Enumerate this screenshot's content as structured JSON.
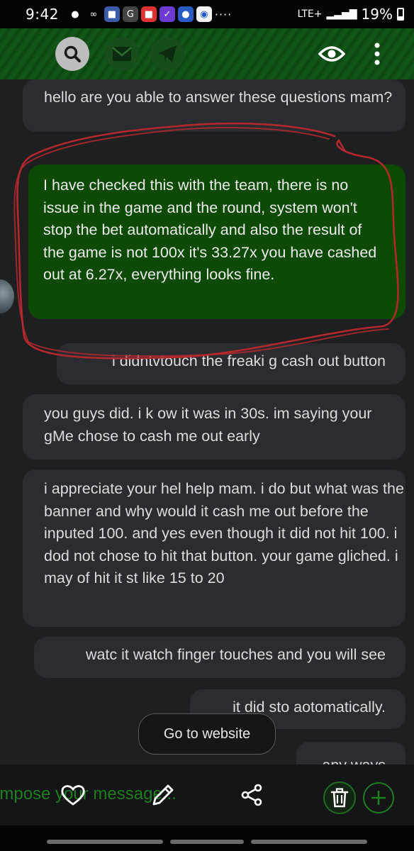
{
  "status_bar": {
    "time": "9:42",
    "network": "LTE+",
    "battery": "19%",
    "more_dots": "····"
  },
  "top_bar": {
    "icons": [
      "search-icon",
      "mail-icon",
      "send-icon",
      "eye-icon",
      "more-vertical-icon"
    ]
  },
  "messages": [
    {
      "side": "left",
      "text": "hello are you able to answer these questions mam?"
    },
    {
      "side": "agent",
      "text": "I have checked this with the team, there is no issue in the game and the round, system won't stop the bet automatically and also the result of the game is not 100x it's 33.27x you have cashed out at 6.27x, everything looks fine."
    },
    {
      "side": "right",
      "text": "i didntvtouch the freaki g cash out button"
    },
    {
      "side": "left",
      "text": "you guys did. i k ow it was in 30s. im saying your gMe chose to cash me out early"
    },
    {
      "side": "left",
      "text": "i appreciate your hel help mam. i do but what was the banner and why would it cash me out before the inputed 100. and yes even though it did not hit 100. i dod not chose to hit that button. your game gliched. i may of hit it st like 15 to 20"
    },
    {
      "side": "right",
      "text": "watc it watch finger touches and you will see"
    },
    {
      "side": "right",
      "text": "it did sto aotomatically."
    },
    {
      "side": "right",
      "text": "any ways"
    }
  ],
  "go_to_website": "Go to website",
  "composer": {
    "placeholder": "ompose your message..."
  },
  "colors": {
    "accent_green": "#1f7d22",
    "agent_bubble": "#0c4a06",
    "annotation_red": "#b3282d"
  }
}
